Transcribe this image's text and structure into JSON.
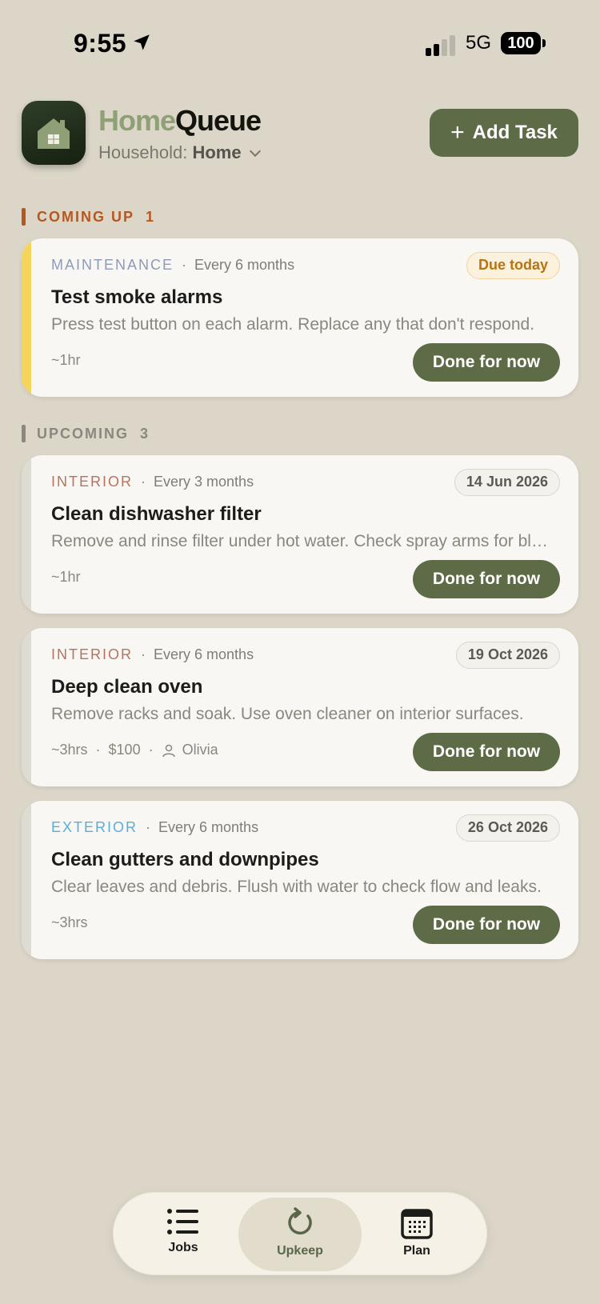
{
  "status": {
    "time": "9:55",
    "network": "5G",
    "battery": "100"
  },
  "header": {
    "brand_part1": "Home",
    "brand_part2": "Queue",
    "household_label": "Household:",
    "household_value": "Home",
    "add_label": "Add Task"
  },
  "sections": {
    "coming_up": {
      "label": "COMING UP",
      "count": "1"
    },
    "upcoming": {
      "label": "UPCOMING",
      "count": "3"
    }
  },
  "tasks": [
    {
      "category": "MAINTENANCE",
      "frequency": "Every 6 months",
      "badge": "Due today",
      "title": "Test smoke alarms",
      "description": "Press test button on each alarm. Replace any that don't respond.",
      "duration": "~1hr",
      "action": "Done for now"
    },
    {
      "category": "INTERIOR",
      "frequency": "Every 3 months",
      "badge": "14 Jun 2026",
      "title": "Clean dishwasher filter",
      "description": "Remove and rinse filter under hot water. Check spray arms for blockages.",
      "duration": "~1hr",
      "action": "Done for now"
    },
    {
      "category": "INTERIOR",
      "frequency": "Every 6 months",
      "badge": "19 Oct 2026",
      "title": "Deep clean oven",
      "description": "Remove racks and soak. Use oven cleaner on interior surfaces.",
      "duration": "~3hrs",
      "cost": "$100",
      "assignee": "Olivia",
      "action": "Done for now"
    },
    {
      "category": "EXTERIOR",
      "frequency": "Every 6 months",
      "badge": "26 Oct 2026",
      "title": "Clean gutters and downpipes",
      "description": "Clear leaves and debris. Flush with water to check flow and leaks.",
      "duration": "~3hrs",
      "action": "Done for now"
    }
  ],
  "nav": {
    "jobs": "Jobs",
    "upkeep": "Upkeep",
    "plan": "Plan",
    "active": "upkeep"
  },
  "colors": {
    "accent": "#5e6b47",
    "background": "#dcd6c9",
    "due_stripe": "#f4d55a",
    "coming_up": "#b6581e"
  },
  "icons": [
    "location-arrow-icon",
    "signal-icon",
    "battery-icon",
    "house-icon",
    "plus-icon",
    "chevron-down-icon",
    "person-icon",
    "list-icon",
    "refresh-icon",
    "calendar-icon"
  ]
}
